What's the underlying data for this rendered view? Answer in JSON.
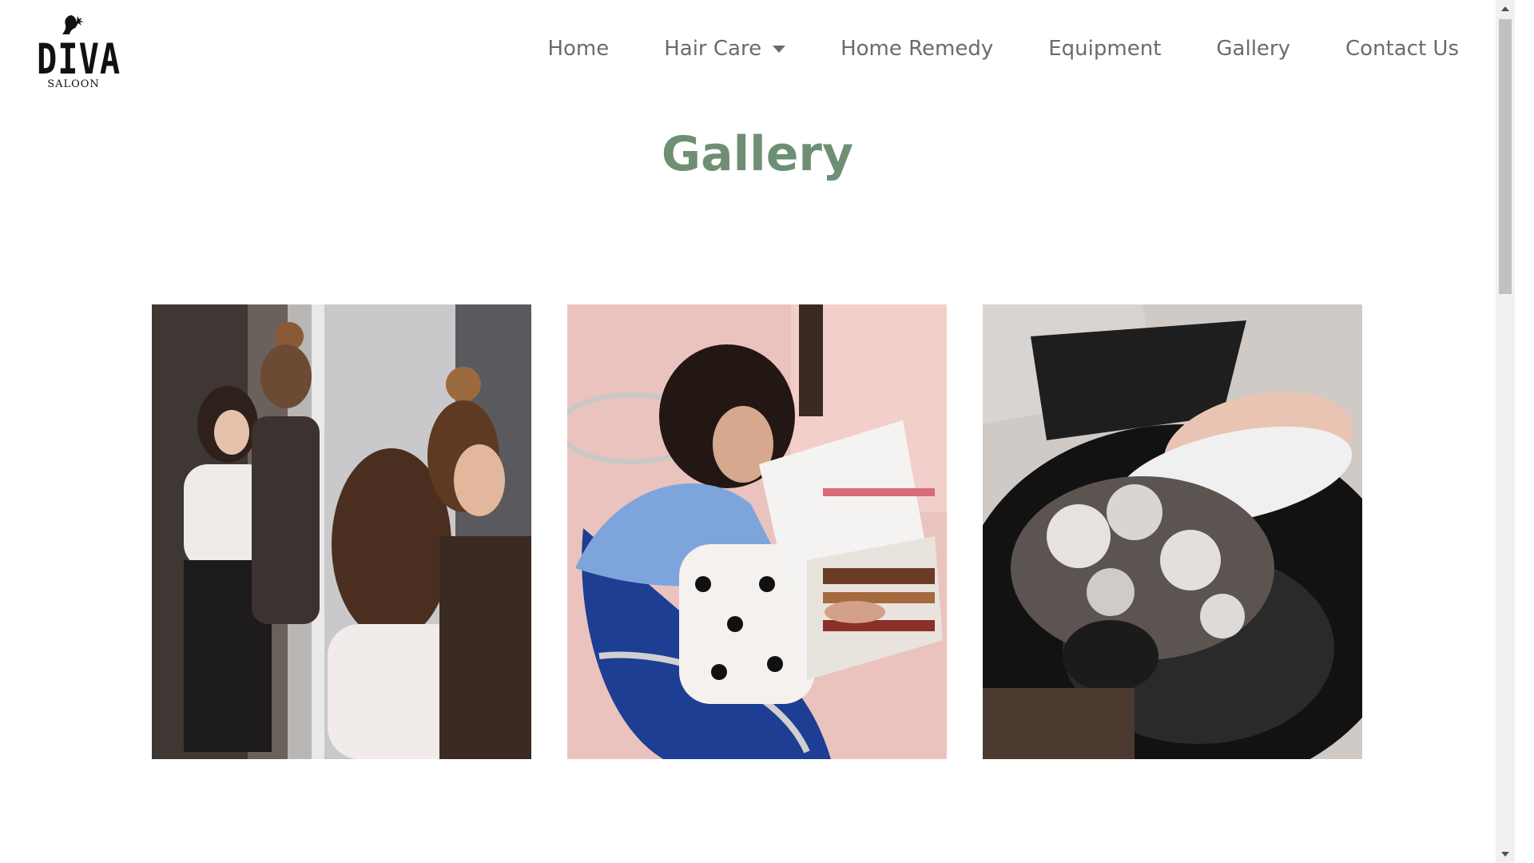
{
  "brand": {
    "name": "DIVA",
    "subtitle": "SALOON",
    "logo_icon": "woman-silhouette-icon"
  },
  "nav": {
    "items": [
      {
        "label": "Home"
      },
      {
        "label": "Hair Care",
        "has_dropdown": true
      },
      {
        "label": "Home Remedy"
      },
      {
        "label": "Equipment"
      },
      {
        "label": "Gallery"
      },
      {
        "label": "Contact Us"
      }
    ]
  },
  "page": {
    "title": "Gallery"
  },
  "gallery": {
    "photos": [
      {
        "subject": "stylists-consulting-at-mirror"
      },
      {
        "subject": "client-choosing-hair-color-swatches"
      },
      {
        "subject": "client-hair-wash-at-basin"
      }
    ]
  },
  "colors": {
    "title_green": "#6f8f75",
    "nav_text": "#6b6b6b",
    "background": "#ffffff"
  }
}
